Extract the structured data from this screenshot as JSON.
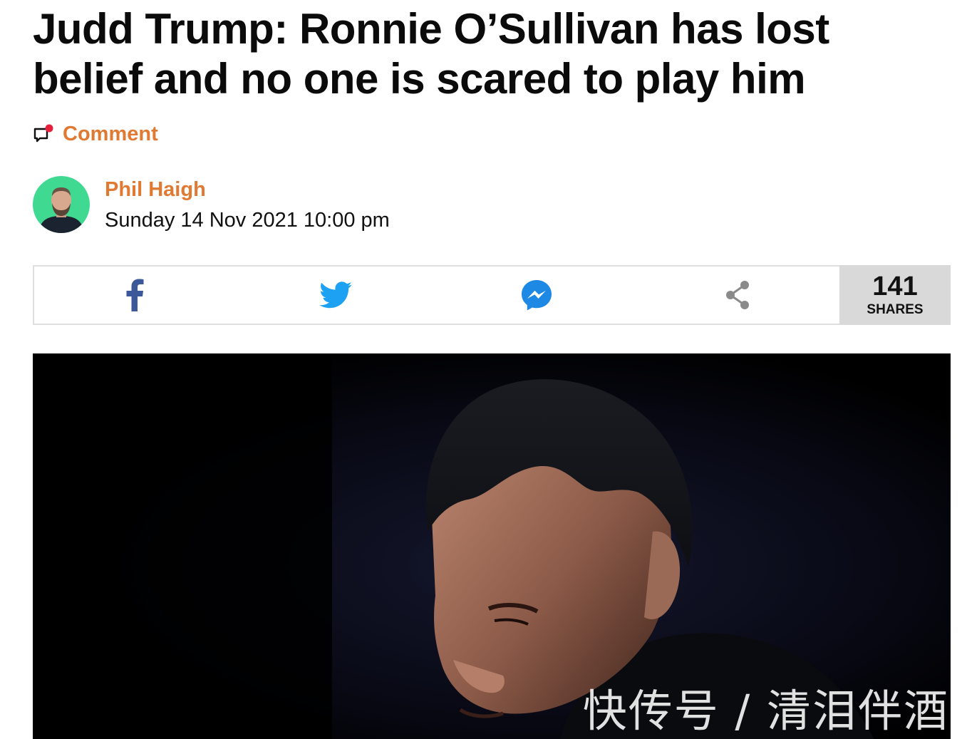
{
  "article": {
    "headline": "Judd Trump: Ronnie O’Sullivan has lost belief and no one is scared to play him",
    "comment_label": "Comment",
    "author_name": "Phil Haigh",
    "publish_date": "Sunday 14 Nov 2021 10:00 pm"
  },
  "share_bar": {
    "buttons": [
      {
        "icon": "facebook-icon",
        "color": "#3b5998"
      },
      {
        "icon": "twitter-icon",
        "color": "#1da1f2"
      },
      {
        "icon": "messenger-icon",
        "color": "#1e88e5"
      },
      {
        "icon": "share-icon",
        "color": "#8a8a8a"
      }
    ],
    "count": "141",
    "count_label": "SHARES"
  },
  "hero_image": {
    "watermark": "快传号 / 清泪伴酒"
  },
  "colors": {
    "accent": "#e07a32",
    "avatar_bg": "#3fd992",
    "share_count_bg": "#d9d9d9"
  }
}
